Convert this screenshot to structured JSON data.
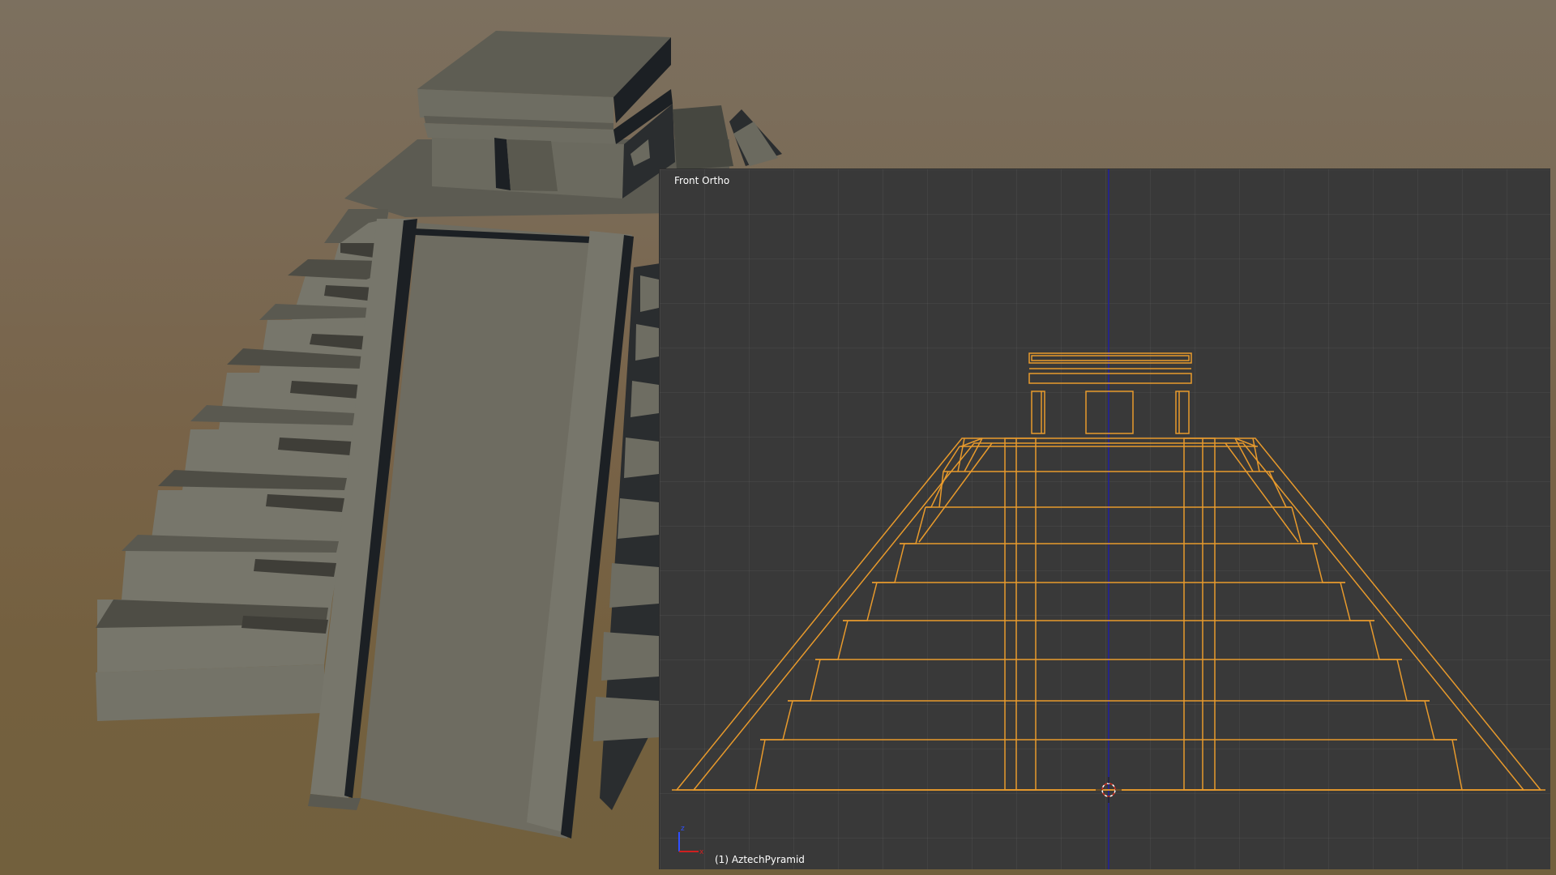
{
  "viewport": {
    "view_name": "Front Ortho",
    "frame_number": "(1)",
    "object_name": "AztechPyramid"
  },
  "axes_gizmo": {
    "up_axis": "z",
    "right_axis": "x"
  },
  "colors": {
    "wireframe_selected": "#e89a2c",
    "ortho_background": "#393939",
    "center_line": "#2020a0",
    "render_stone": "#77766b",
    "render_shadow": "#1c2024",
    "render_background_top": "#7c705f",
    "render_background_bottom": "#72603d"
  }
}
